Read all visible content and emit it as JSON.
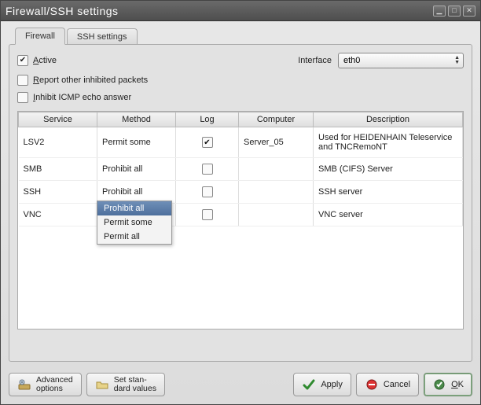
{
  "window": {
    "title": "Firewall/SSH settings"
  },
  "tabs": {
    "firewall": "Firewall",
    "ssh": "SSH settings"
  },
  "controls": {
    "active_prefix": "A",
    "active_rest": "ctive",
    "report_prefix": "R",
    "report_rest": "eport other inhibited packets",
    "inhibit_prefix": "I",
    "inhibit_rest": "nhibit ICMP echo answer",
    "interface_label": "Interface",
    "interface_value": "eth0"
  },
  "table": {
    "columns": {
      "service": "Service",
      "method": "Method",
      "log": "Log",
      "computer": "Computer",
      "description": "Description"
    },
    "rows": [
      {
        "service": "LSV2",
        "method": "Permit some",
        "log": true,
        "computer": "Server_05",
        "description": "Used for HEIDENHAIN Teleservice and TNCRemoNT"
      },
      {
        "service": "SMB",
        "method": "Prohibit all",
        "log": false,
        "computer": "",
        "description": "SMB (CIFS) Server"
      },
      {
        "service": "SSH",
        "method": "Prohibit all",
        "log": false,
        "computer": "",
        "description": "SSH server"
      },
      {
        "service": "VNC",
        "method": "",
        "log": false,
        "computer": "",
        "description": "VNC server"
      }
    ]
  },
  "dropdown": {
    "options": {
      "prohibit_all": "Prohibit all",
      "permit_some": "Permit some",
      "permit_all": "Permit all"
    },
    "selected": "Prohibit all"
  },
  "footer": {
    "advanced_l1": "Advanced",
    "advanced_l2": "options",
    "standard_l1": "Set stan-",
    "standard_l2": "dard values",
    "apply": "Apply",
    "cancel": "Cancel",
    "ok_prefix": "O",
    "ok_rest": "K"
  }
}
